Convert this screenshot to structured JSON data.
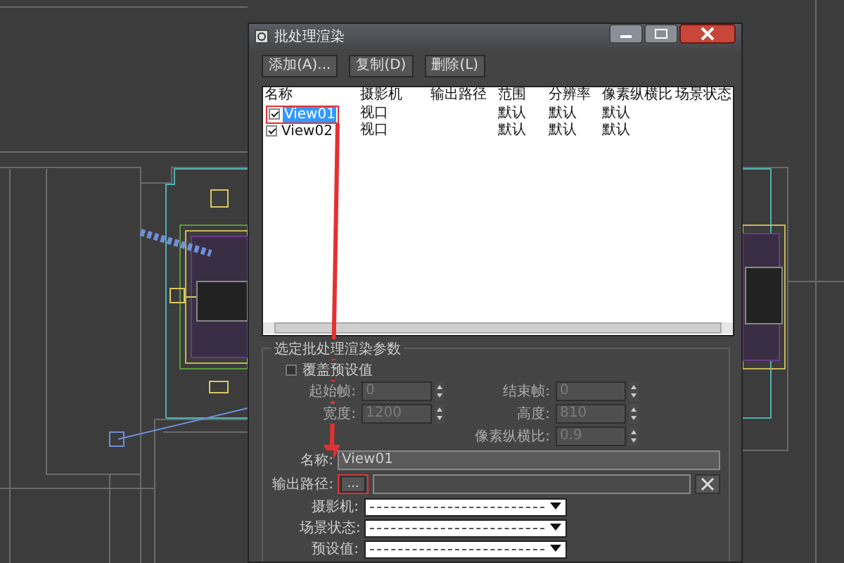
{
  "window": {
    "title": "批处理渲染"
  },
  "toolbar": [
    "添加(A)...",
    "复制(D)",
    "删除(L)"
  ],
  "table": {
    "columns": [
      "名称",
      "摄影机",
      "输出路径",
      "范围",
      "分辨率",
      "像素纵横比",
      "场景状态"
    ],
    "rows": [
      {
        "checked": true,
        "selected": true,
        "name": "View01",
        "camera": "视口",
        "range": "默认",
        "resolution": "默认",
        "pixel_aspect": "默认"
      },
      {
        "checked": true,
        "selected": false,
        "name": "View02",
        "camera": "视口",
        "range": "默认",
        "resolution": "默认",
        "pixel_aspect": "默认"
      }
    ]
  },
  "params": {
    "title": "选定批处理渲染参数",
    "override": {
      "label": "覆盖预设值",
      "checked": false
    },
    "spinners": [
      {
        "label": "起始帧:",
        "value": "0"
      },
      {
        "label": "结束帧:",
        "value": "0"
      },
      {
        "label": "宽度:",
        "value": "1200"
      },
      {
        "label": "高度:",
        "value": "810"
      },
      {
        "label": "像素纵横比:",
        "value": "0.9"
      }
    ],
    "name": {
      "label": "名称:",
      "value": "View01"
    },
    "output_path": {
      "label": "输出路径:",
      "button": "..."
    },
    "dropdowns": [
      {
        "label": "摄影机:"
      },
      {
        "label": "场景状态:"
      },
      {
        "label": "预设值:"
      }
    ]
  }
}
